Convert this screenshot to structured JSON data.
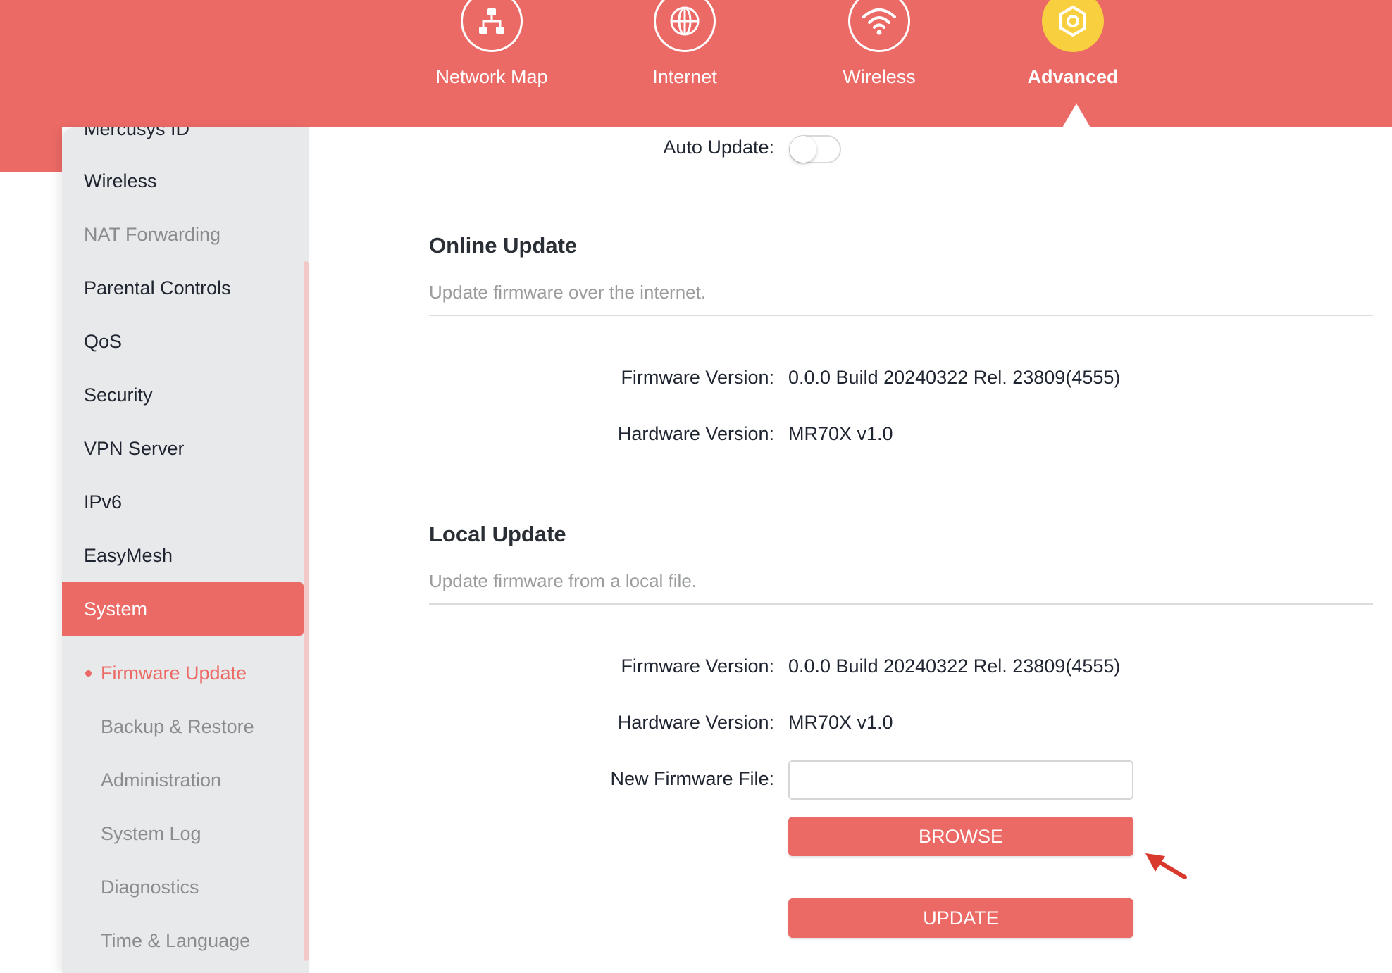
{
  "top_nav": {
    "items": [
      {
        "label": "Network Map",
        "icon": "network-map-icon"
      },
      {
        "label": "Internet",
        "icon": "globe-icon"
      },
      {
        "label": "Wireless",
        "icon": "wifi-icon"
      },
      {
        "label": "Advanced",
        "icon": "gear-icon",
        "active": true
      }
    ]
  },
  "sidebar": {
    "items": [
      {
        "label": "Mercusys ID"
      },
      {
        "label": "Wireless"
      },
      {
        "label": "NAT Forwarding"
      },
      {
        "label": "Parental Controls"
      },
      {
        "label": "QoS"
      },
      {
        "label": "Security"
      },
      {
        "label": "VPN Server"
      },
      {
        "label": "IPv6"
      },
      {
        "label": "EasyMesh"
      },
      {
        "label": "System",
        "active": true
      }
    ],
    "sub_items": [
      {
        "label": "Firmware Update",
        "active": true
      },
      {
        "label": "Backup & Restore"
      },
      {
        "label": "Administration"
      },
      {
        "label": "System Log"
      },
      {
        "label": "Diagnostics"
      },
      {
        "label": "Time & Language"
      }
    ]
  },
  "auto_update": {
    "label": "Auto Update:",
    "enabled": false
  },
  "online_update": {
    "title": "Online Update",
    "subtitle": "Update firmware over the internet.",
    "firmware_label": "Firmware Version:",
    "firmware_value": "0.0.0 Build 20240322 Rel. 23809(4555)",
    "hardware_label": "Hardware Version:",
    "hardware_value": "MR70X v1.0"
  },
  "local_update": {
    "title": "Local Update",
    "subtitle": "Update firmware from a local file.",
    "firmware_label": "Firmware Version:",
    "firmware_value": "0.0.0 Build 20240322 Rel. 23809(4555)",
    "hardware_label": "Hardware Version:",
    "hardware_value": "MR70X v1.0",
    "file_label": "New Firmware File:",
    "file_value": "",
    "browse_label": "BROWSE",
    "update_label": "UPDATE"
  },
  "colors": {
    "brand": "#ec6a66",
    "active_icon": "#f7cf3f",
    "annotation_arrow": "#d9382c"
  }
}
